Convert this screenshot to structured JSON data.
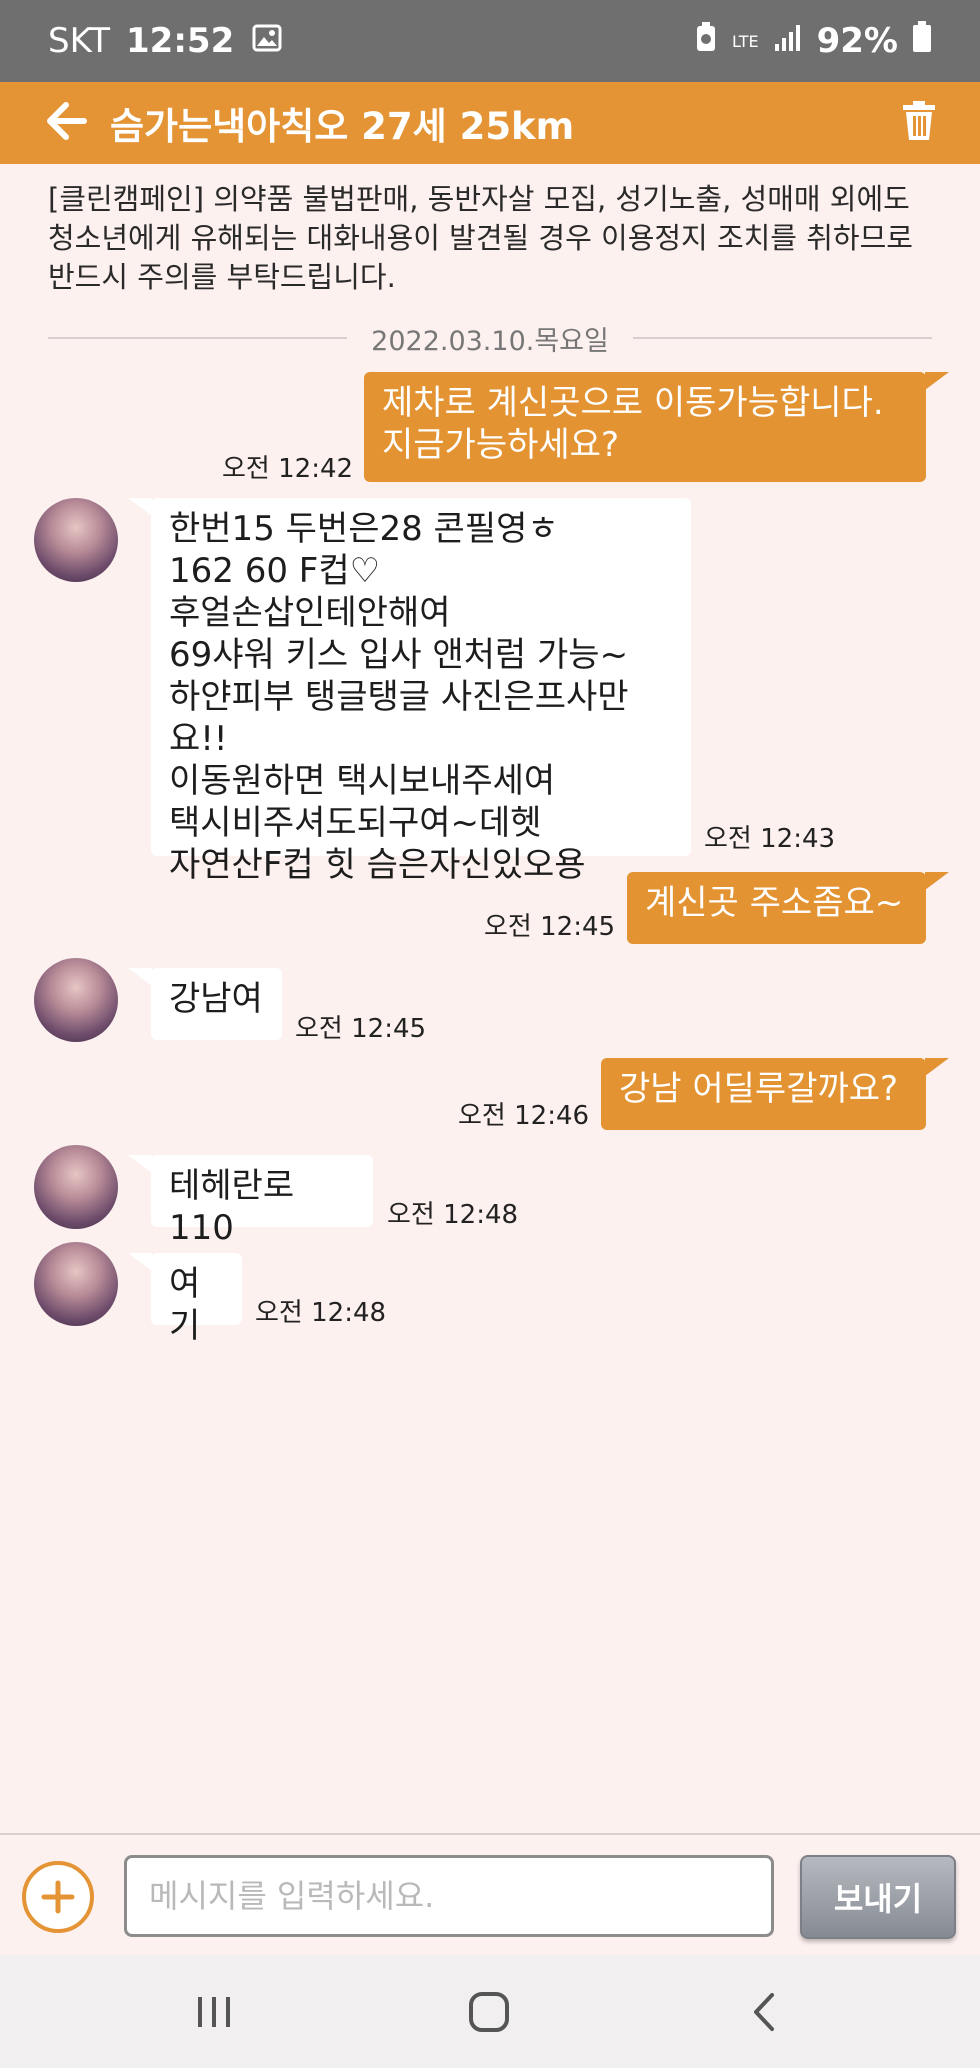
{
  "status_bar": {
    "carrier": "SKT",
    "time": "12:52",
    "network": "LTE",
    "battery": "92%"
  },
  "header": {
    "title": "슴가는낵아칙오 27세 25km"
  },
  "notice": "[클린캠페인] 의약품 불법판매, 동반자살 모집, 성기노출, 성매매 외에도 청소년에게 유해되는 대화내용이 발견될 경우 이용정지 조치를 취하므로 반드시 주의를 부탁드립니다.",
  "date_divider": "2022.03.10.목요일",
  "messages": [
    {
      "dir": "out",
      "text": "제차로 계신곳으로 이동가능합니다.\n지금가능하세요?",
      "time": "오전 12:42"
    },
    {
      "dir": "in",
      "text": "한번15 두번은28 콘필영ㅎ\n162 60 F컵♡\n후얼손삽인테안해여\n69샤워 키스 입사 앤처럼 가능~\n하얀피부 탱글탱글 사진은프사만요!!\n이동원하면 택시보내주세여\n택시비주셔도되구여~데헷\n자연산F컵 힛 슴은자신있오용",
      "time": "오전 12:43"
    },
    {
      "dir": "out",
      "text": "계신곳 주소좀요~",
      "time": "오전 12:45"
    },
    {
      "dir": "in",
      "text": "강남여",
      "time": "오전 12:45"
    },
    {
      "dir": "out",
      "text": "강남 어딜루갈까요?",
      "time": "오전 12:46"
    },
    {
      "dir": "in",
      "text": "테헤란로110",
      "time": "오전 12:48"
    },
    {
      "dir": "in",
      "text": "여기",
      "time": "오전 12:48"
    }
  ],
  "composer": {
    "placeholder": "메시지를 입력하세요.",
    "send_label": "보내기"
  },
  "colors": {
    "accent": "#e49435",
    "outgoing_bubble": "#e39332",
    "background": "#fdf1f0"
  }
}
